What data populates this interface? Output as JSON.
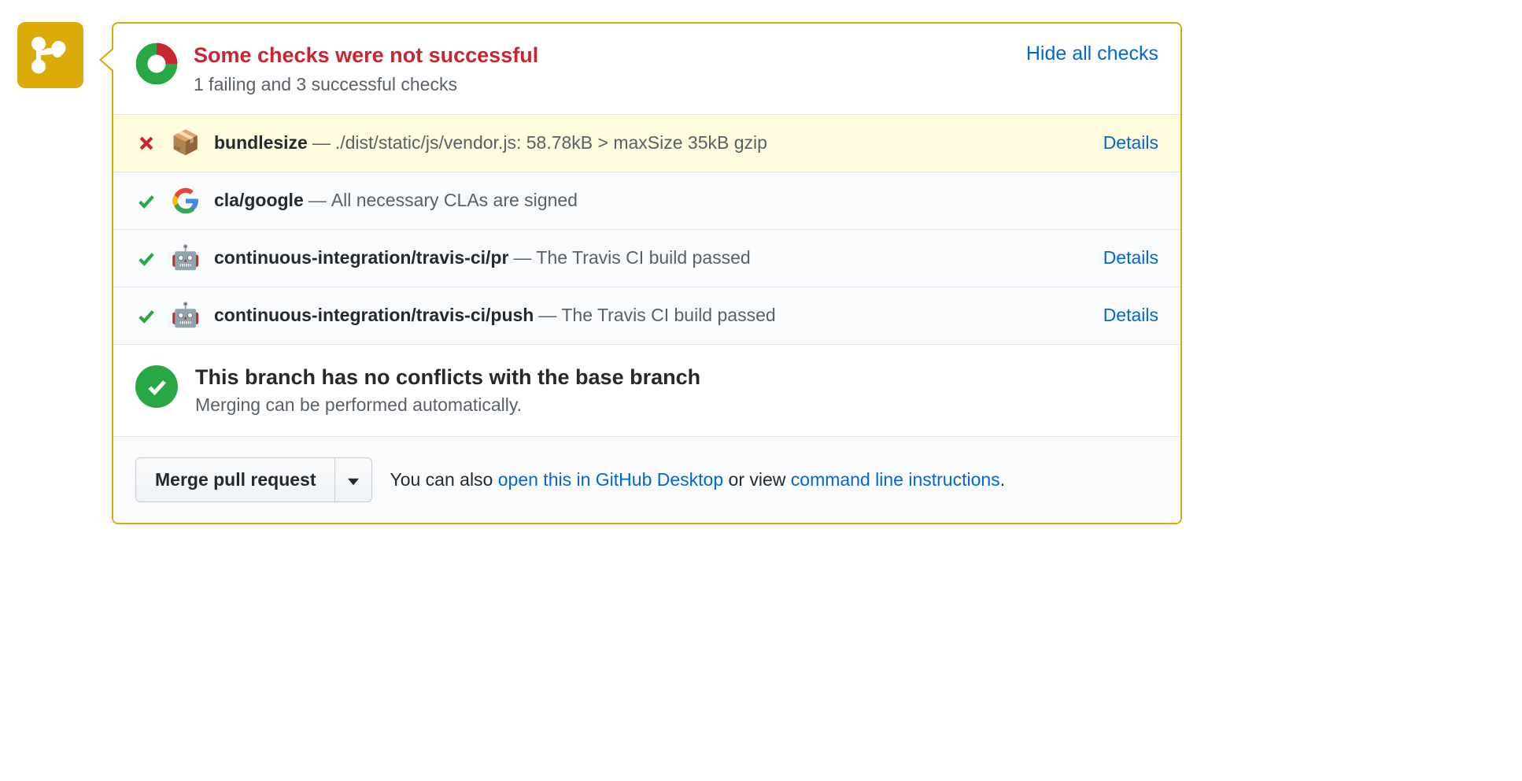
{
  "summary": {
    "title": "Some checks were not successful",
    "subtitle": "1 failing and 3 successful checks",
    "toggle_label": "Hide all checks"
  },
  "checks": [
    {
      "status": "fail",
      "icon": "package-icon",
      "name": "bundlesize",
      "message": "./dist/static/js/vendor.js: 58.78kB > maxSize 35kB gzip",
      "details_label": "Details",
      "has_details": true
    },
    {
      "status": "pass",
      "icon": "google-icon",
      "name": "cla/google",
      "message": "All necessary CLAs are signed",
      "details_label": "",
      "has_details": false
    },
    {
      "status": "pass",
      "icon": "travis-icon",
      "name": "continuous-integration/travis-ci/pr",
      "message": "The Travis CI build passed",
      "details_label": "Details",
      "has_details": true
    },
    {
      "status": "pass",
      "icon": "travis-icon",
      "name": "continuous-integration/travis-ci/push",
      "message": "The Travis CI build passed",
      "details_label": "Details",
      "has_details": true
    }
  ],
  "conflict": {
    "title": "This branch has no conflicts with the base branch",
    "subtitle": "Merging can be performed automatically."
  },
  "merge": {
    "button_label": "Merge pull request",
    "hint_prefix": "You can also ",
    "hint_desktop": "open this in GitHub Desktop",
    "hint_middle": " or view ",
    "hint_cli": "command line instructions",
    "hint_suffix": "."
  }
}
